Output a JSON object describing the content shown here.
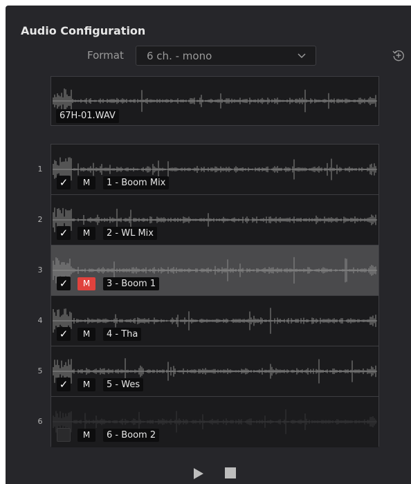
{
  "panel": {
    "title": "Audio Configuration",
    "format_label": "Format",
    "format_value": "6 ch. - mono",
    "reset_icon": "reset-history-icon"
  },
  "master_clip": {
    "label": "67H-01.WAV"
  },
  "tracks": [
    {
      "number": "1",
      "label": "1 - Boom Mix",
      "enabled": true,
      "muted": false,
      "selected": false
    },
    {
      "number": "2",
      "label": "2 - WL Mix",
      "enabled": true,
      "muted": false,
      "selected": false
    },
    {
      "number": "3",
      "label": "3 - Boom 1",
      "enabled": true,
      "muted": true,
      "selected": true
    },
    {
      "number": "4",
      "label": "4 - Tha",
      "enabled": true,
      "muted": false,
      "selected": false
    },
    {
      "number": "5",
      "label": "5 - Wes",
      "enabled": true,
      "muted": false,
      "selected": false
    },
    {
      "number": "6",
      "label": "6 - Boom 2",
      "enabled": false,
      "muted": false,
      "selected": false
    }
  ],
  "mute_label": "M",
  "check_glyph": "✓",
  "transport": {
    "play_icon": "play-icon",
    "stop_icon": "stop-icon"
  },
  "colors": {
    "panel_bg": "#26262a",
    "track_bg": "#1b1b1d",
    "selected_track_bg": "#4a4a4c",
    "waveform": "#8c8c8c",
    "mute_active": "#e0423d"
  }
}
